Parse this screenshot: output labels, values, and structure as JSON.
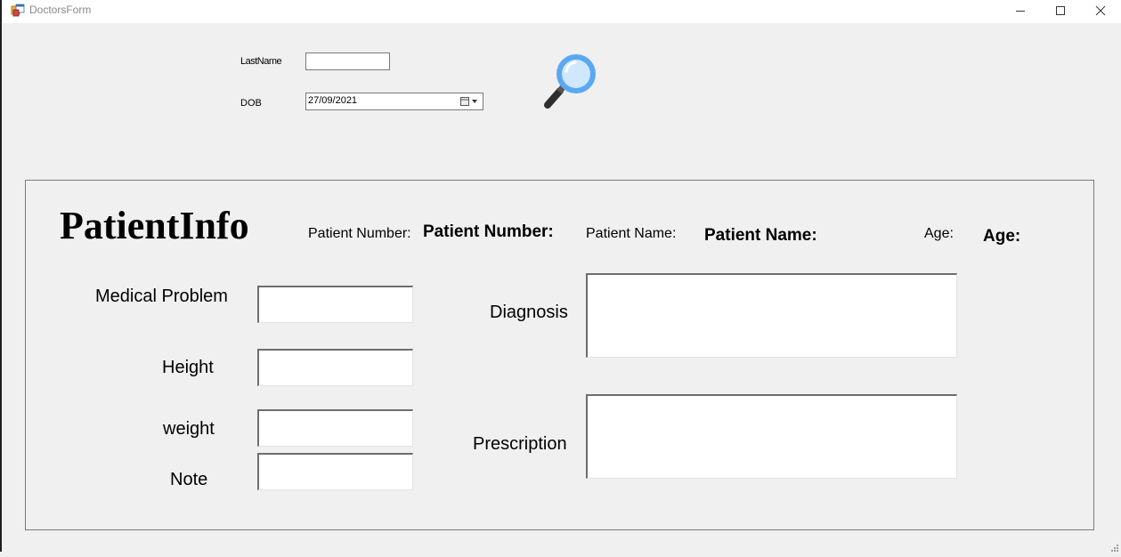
{
  "window": {
    "title": "DoctorsForm"
  },
  "search": {
    "lastname_label": "LastName",
    "lastname_value": "",
    "dob_label": "DOB",
    "dob_value": "27/09/2021",
    "search_icon": "magnifier-icon"
  },
  "patient_info": {
    "title": "PatientInfo",
    "patient_number_label": "Patient Number:",
    "patient_number_value": "Patient Number:",
    "patient_name_label": "Patient Name:",
    "patient_name_value": "Patient Name:",
    "age_label": "Age:",
    "age_value": "Age:"
  },
  "fields": {
    "medical_problem_label": "Medical Problem",
    "height_label": "Height",
    "weight_label": "weight",
    "note_label": "Note",
    "diagnosis_label": "Diagnosis",
    "prescription_label": "Prescription"
  }
}
